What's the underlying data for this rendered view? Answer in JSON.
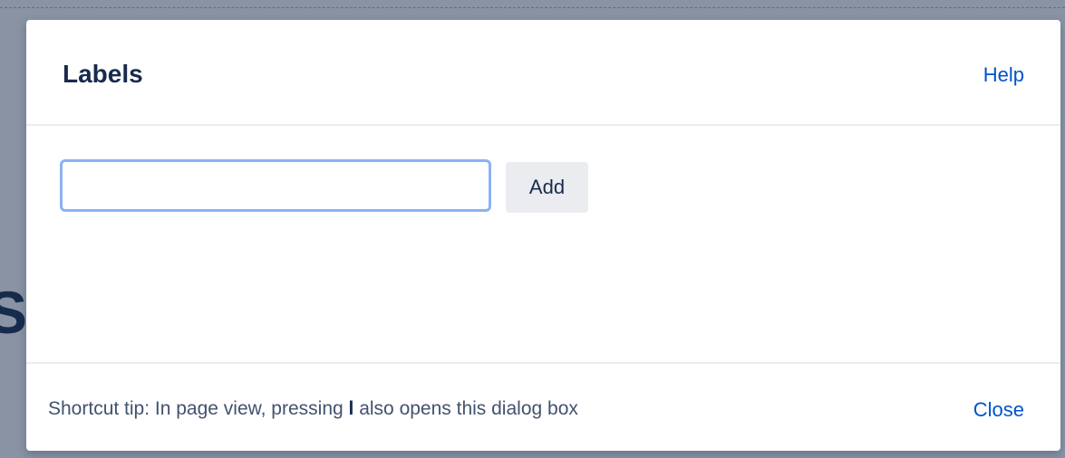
{
  "dialog": {
    "title": "Labels",
    "help_label": "Help",
    "input_value": "",
    "add_label": "Add",
    "footer": {
      "tip_prefix": "Shortcut tip: In page view, pressing ",
      "tip_key": "l",
      "tip_suffix": " also opens this dialog box",
      "close_label": "Close"
    }
  },
  "background": {
    "partial_heading_glyph": "S]"
  },
  "colors": {
    "link": "#0052cc",
    "title": "#172b4d",
    "input_focus_border": "#8ab3f1",
    "button_bg": "#ebecf0",
    "backdrop": "#8993a4"
  }
}
